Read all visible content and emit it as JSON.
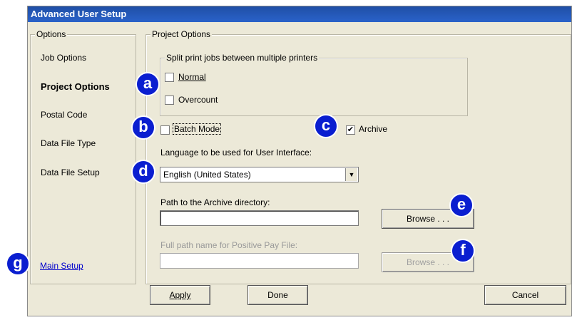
{
  "window": {
    "title": "Advanced User Setup"
  },
  "options": {
    "legend": "Options",
    "items": [
      {
        "label": "Job Options"
      },
      {
        "label": "Project Options"
      },
      {
        "label": "Postal Code"
      },
      {
        "label": "Data File Type"
      },
      {
        "label": "Data File Setup"
      }
    ],
    "main_setup_link": "Main Setup"
  },
  "project_options": {
    "legend": "Project Options",
    "split": {
      "legend": "Split print jobs between multiple printers",
      "normal_label": "Normal",
      "normal_checked": false,
      "overcount_label": "Overcount",
      "overcount_checked": false
    },
    "batch_mode_label": "Batch Mode",
    "batch_mode_checked": false,
    "archive_label": "Archive",
    "archive_checked": true,
    "checkmark": "✔",
    "language_label": "Language to be used for User Interface:",
    "language_value": "English (United States)",
    "archive_path_label": "Path to the Archive directory:",
    "archive_path_value": "",
    "browse_label": "Browse . . .",
    "positive_pay_label": "Full path name for Positive Pay File:",
    "positive_pay_value": "",
    "browse2_label": "Browse . . ."
  },
  "buttons": {
    "apply": "Apply",
    "done": "Done",
    "cancel": "Cancel"
  },
  "callouts": {
    "a": "a",
    "b": "b",
    "c": "c",
    "d": "d",
    "e": "e",
    "f": "f",
    "g": "g"
  },
  "icons": {
    "dropdown": "chevron-down-icon"
  }
}
